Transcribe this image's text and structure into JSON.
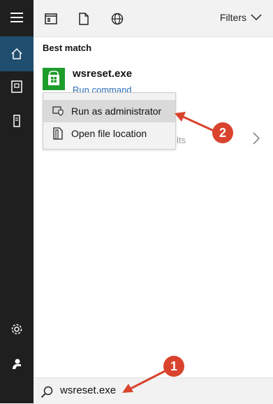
{
  "colors": {
    "rail_bg": "#1f1f1f",
    "rail_active": "#1f4e6e",
    "store_green": "#1f9d2c",
    "link_blue": "#2c6fb7",
    "annotation_red": "#d9432d"
  },
  "topbar": {
    "filters_label": "Filters"
  },
  "results": {
    "section_title": "Best match",
    "app_name": "wsreset.exe",
    "app_subtitle": "Run command",
    "faded_suffix": "lts"
  },
  "context_menu": {
    "items": [
      {
        "label": "Run as administrator",
        "icon": "shield-icon"
      },
      {
        "label": "Open file location",
        "icon": "folder-icon"
      }
    ]
  },
  "search": {
    "value": "wsreset.exe"
  },
  "annotations": {
    "badge_1": "1",
    "badge_2": "2"
  }
}
